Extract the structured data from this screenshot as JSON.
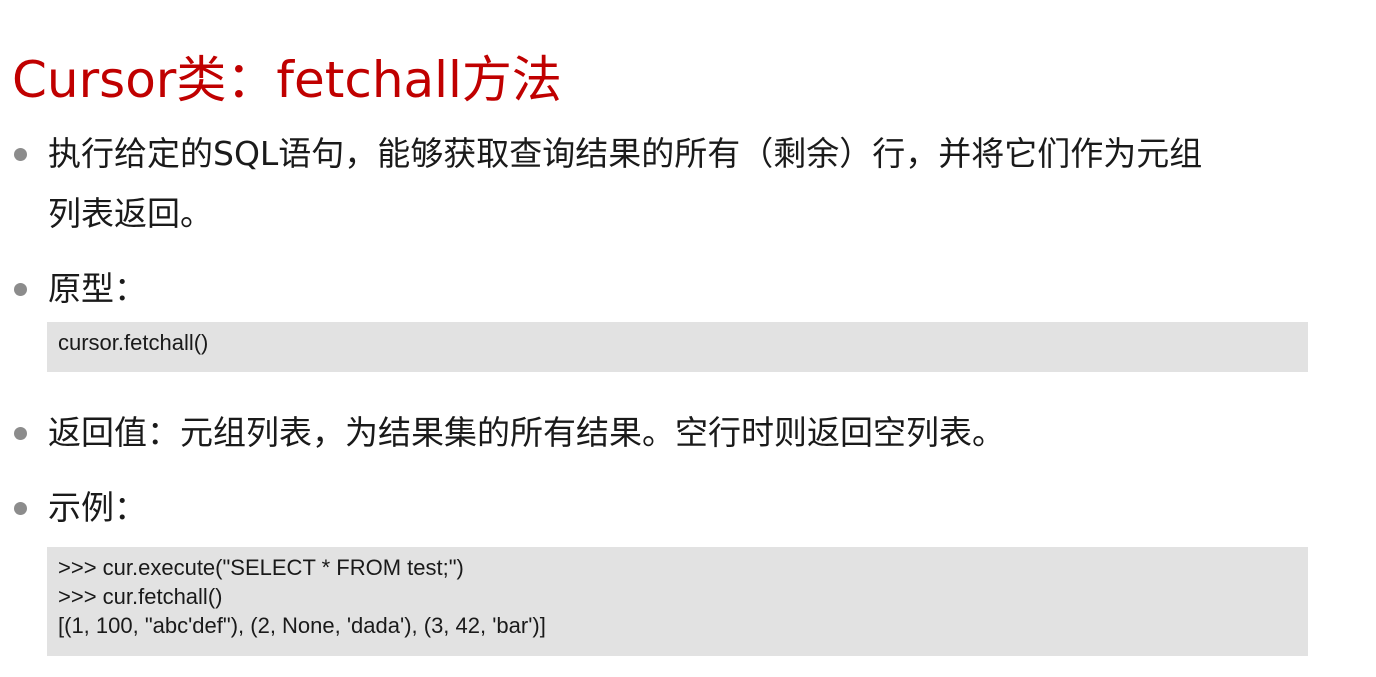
{
  "title": "Cursor类：fetchall方法",
  "bullets": {
    "description_line1": "执行给定的SQL语句，能够获取查询结果的所有（剩余）行，并将它们作为元组",
    "description_line2": "列表返回。",
    "prototype_label": "原型：",
    "return_value": "返回值：元组列表，为结果集的所有结果。空行时则返回空列表。",
    "example_label": "示例："
  },
  "prototype_code": [
    "cursor.fetchall()"
  ],
  "example_code": [
    ">>> cur.execute(\"SELECT * FROM test;\")",
    ">>> cur.fetchall()",
    "[(1, 100, \"abc'def\"), (2, None, 'dada'), (3, 42, 'bar')]"
  ],
  "colors": {
    "title": "#c00000",
    "bullet": "#8c8c8c",
    "code_background": "#e2e2e2"
  }
}
